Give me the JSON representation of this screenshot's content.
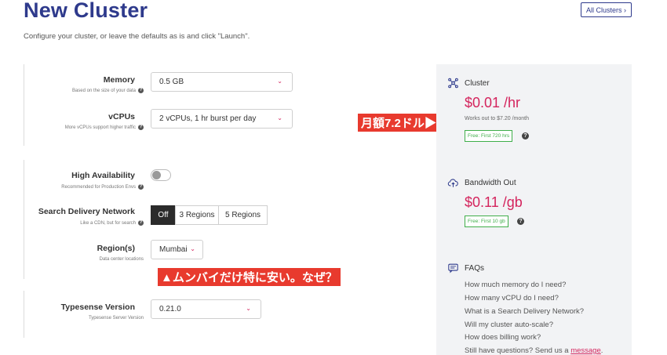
{
  "header": {
    "title": "New Cluster",
    "all_clusters_label": "All Clusters ›",
    "subtitle": "Configure your cluster, or leave the defaults as is and click \"Launch\"."
  },
  "form": {
    "memory": {
      "label": "Memory",
      "sub": "Based on the size of your data",
      "value": "0.5 GB"
    },
    "vcpus": {
      "label": "vCPUs",
      "sub": "More vCPUs support higher traffic",
      "value": "2 vCPUs, 1 hr burst per day"
    },
    "high_availability": {
      "label": "High Availability",
      "sub": "Recommended for Production Envs",
      "enabled": false
    },
    "sdn": {
      "label": "Search Delivery Network",
      "sub": "Like a CDN, but for search",
      "options": [
        "Off",
        "3 Regions",
        "5 Regions"
      ],
      "selected": "Off"
    },
    "regions": {
      "label": "Region(s)",
      "sub": "Data center locations",
      "value": "Mumbai"
    },
    "version": {
      "label": "Typesense Version",
      "sub": "Typesense Server Version",
      "value": "0.21.0"
    }
  },
  "annotations": {
    "price_note": "月額7.2ドル▶",
    "region_note": "▲ムンバイだけ特に安い。なぜ？"
  },
  "sidebar": {
    "cluster": {
      "title": "Cluster",
      "price": "$0.01 /hr",
      "note": "Works out to $7.20 /month",
      "free": "Free: First 720 hrs"
    },
    "bandwidth": {
      "title": "Bandwidth Out",
      "price": "$0.11 /gb",
      "free": "Free: First 10 gb"
    },
    "faqs": {
      "title": "FAQs",
      "items": [
        "How much memory do I need?",
        "How many vCPU do I need?",
        "What is a Search Delivery Network?",
        "Will my cluster auto-scale?",
        "How does billing work?"
      ],
      "last_prefix": "Still have questions? Send us a ",
      "last_link": "message",
      "last_suffix": "."
    }
  },
  "colors": {
    "title": "#2e3a8c",
    "accent": "#d4245d",
    "free_green": "#3fae49",
    "annotation_red": "#e83a2e"
  }
}
